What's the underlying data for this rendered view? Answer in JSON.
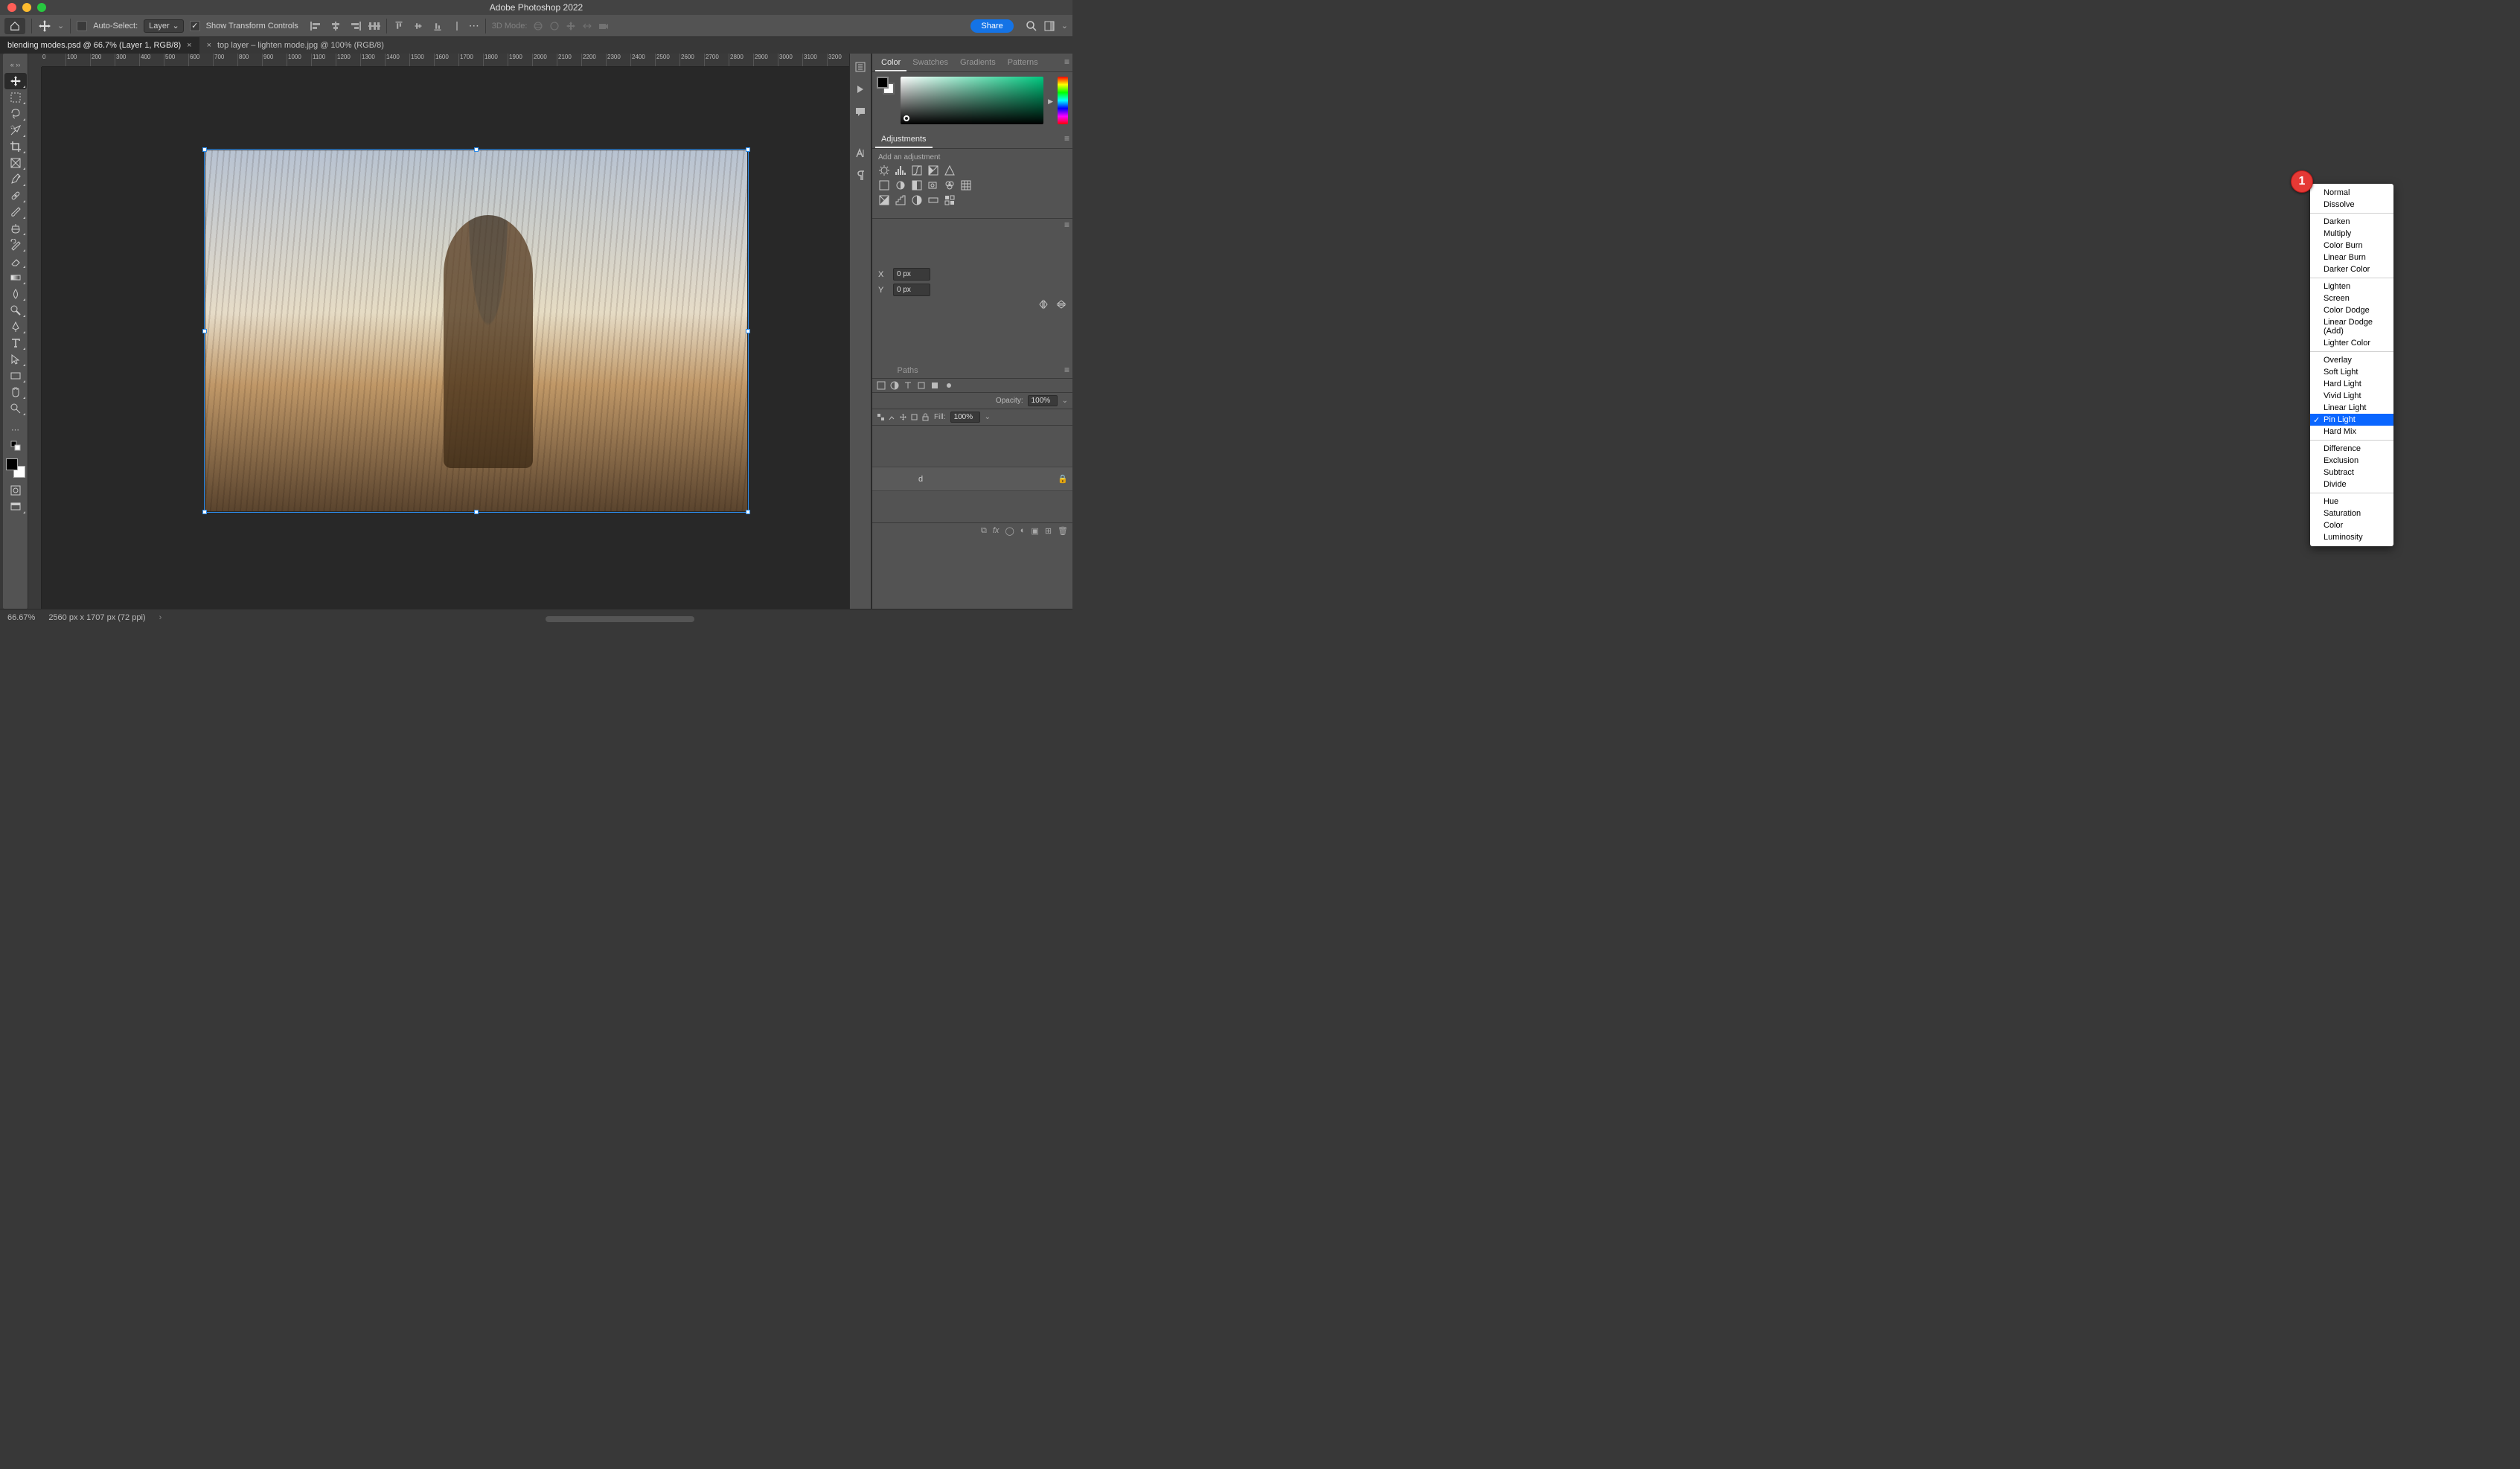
{
  "title_bar": {
    "app_title": "Adobe Photoshop 2022"
  },
  "options_bar": {
    "auto_select_label": "Auto-Select:",
    "auto_select_target": "Layer",
    "show_transform_label": "Show Transform Controls",
    "threed_mode_label": "3D Mode:",
    "share_label": "Share"
  },
  "doc_tabs": {
    "tab1": "blending modes.psd @ 66.7% (Layer 1, RGB/8)",
    "tab2": "top layer – lighten mode.jpg @ 100% (RGB/8)"
  },
  "ruler_ticks": [
    "0",
    "100",
    "200",
    "300",
    "400",
    "500",
    "600",
    "700",
    "800",
    "900",
    "1000",
    "1100",
    "1200",
    "1300",
    "1400",
    "1500",
    "1600",
    "1700",
    "1800",
    "1900",
    "2000",
    "2100",
    "2200",
    "2300",
    "2400",
    "2500",
    "2600",
    "2700",
    "2800",
    "2900",
    "3000",
    "3100",
    "3200"
  ],
  "panels": {
    "color": {
      "tabs": [
        "Color",
        "Swatches",
        "Gradients",
        "Patterns"
      ]
    },
    "adjustments": {
      "tab": "Adjustments",
      "add_label": "Add an adjustment"
    },
    "properties": {
      "tabs_hidden": "Paths",
      "x_label": "X",
      "x_value": "0 px",
      "y_label": "Y",
      "y_value": "0 px"
    },
    "layers": {
      "tabs": [
        "Paths"
      ],
      "opacity_label": "Opacity:",
      "opacity_value": "100%",
      "fill_label": "Fill:",
      "fill_value": "100%",
      "bg_layer_label_trail": "d"
    }
  },
  "blend_modes": {
    "groups": [
      [
        "Normal",
        "Dissolve"
      ],
      [
        "Darken",
        "Multiply",
        "Color Burn",
        "Linear Burn",
        "Darker Color"
      ],
      [
        "Lighten",
        "Screen",
        "Color Dodge",
        "Linear Dodge (Add)",
        "Lighter Color"
      ],
      [
        "Overlay",
        "Soft Light",
        "Hard Light",
        "Vivid Light",
        "Linear Light",
        "Pin Light",
        "Hard Mix"
      ],
      [
        "Difference",
        "Exclusion",
        "Subtract",
        "Divide"
      ],
      [
        "Hue",
        "Saturation",
        "Color",
        "Luminosity"
      ]
    ],
    "selected": "Pin Light"
  },
  "annotation": {
    "num": "1"
  },
  "status_bar": {
    "zoom": "66.67%",
    "doc_info": "2560 px x 1707 px (72 ppi)"
  }
}
